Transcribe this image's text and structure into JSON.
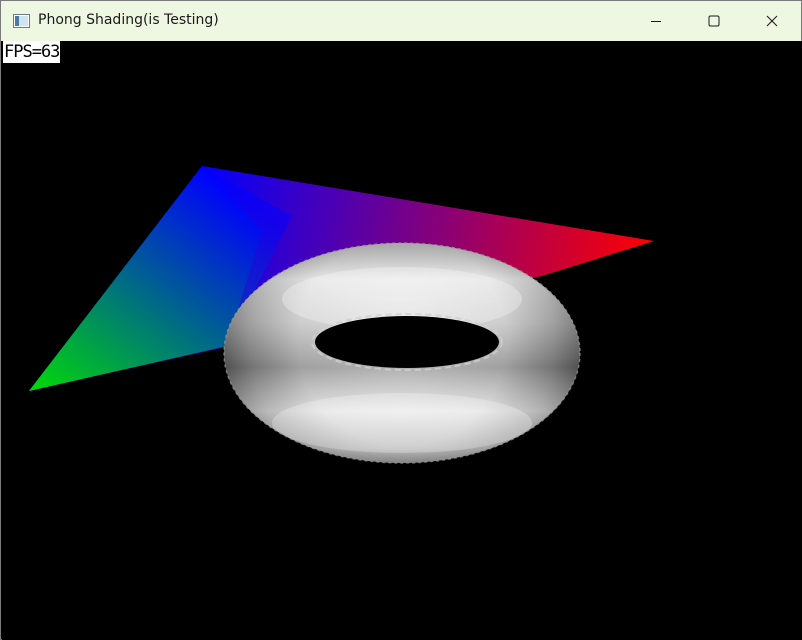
{
  "window": {
    "title": "Phong Shading(is Testing)",
    "app_icon": "window-app-icon",
    "controls": {
      "minimize_icon": "minimize-icon",
      "maximize_icon": "maximize-icon",
      "close_icon": "close-icon"
    }
  },
  "overlay": {
    "fps_text": "FPS=63"
  },
  "scene": {
    "objects": [
      "gradient-quad",
      "shaded-torus"
    ],
    "quad_corner_colors": {
      "back": "#0000ff",
      "right": "#ff0000",
      "left": "#00ff00"
    },
    "background": "#000000"
  }
}
